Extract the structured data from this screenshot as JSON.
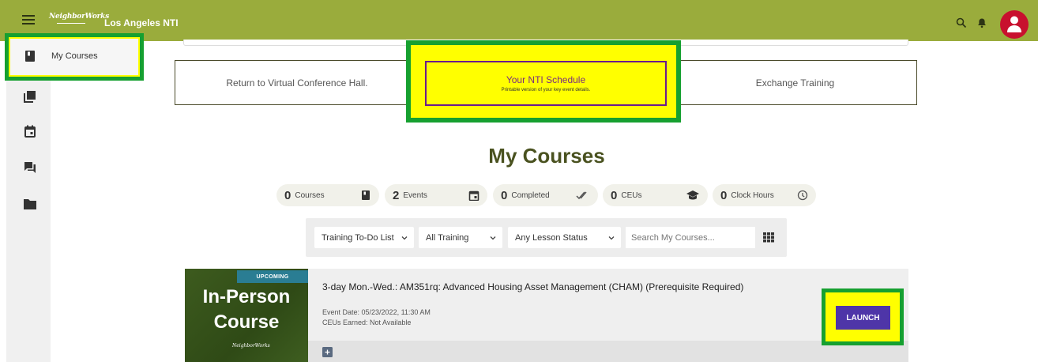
{
  "header": {
    "logo_text": "NeighborWorks",
    "app_title": "Los Angeles NTI",
    "icons": [
      "menu-icon",
      "search-icon",
      "bell-icon",
      "user-avatar-icon"
    ]
  },
  "sidebar": {
    "active_item_label": "My Courses",
    "icons": [
      "book-icon",
      "library-icon",
      "calendar-icon",
      "chat-icon",
      "folder-icon"
    ]
  },
  "nav": {
    "return_label": "Return to Virtual Conference Hall.",
    "schedule_title": "Your NTI Schedule",
    "schedule_subtitle": "Printable version of your key event details.",
    "exchange_label": "Exchange Training"
  },
  "page_title": "My Courses",
  "stats": [
    {
      "value": "0",
      "label": "Courses",
      "icon": "book-icon"
    },
    {
      "value": "2",
      "label": "Events",
      "icon": "calendar-icon"
    },
    {
      "value": "0",
      "label": "Completed",
      "icon": "double-check-icon"
    },
    {
      "value": "0",
      "label": "CEUs",
      "icon": "graduation-cap-icon"
    },
    {
      "value": "0",
      "label": "Clock Hours",
      "icon": "clock-icon"
    }
  ],
  "filters": {
    "list": "Training To-Do List",
    "training": "All Training",
    "status": "Any Lesson Status",
    "search_placeholder": "Search My Courses..."
  },
  "course": {
    "badge": "UPCOMING",
    "thumb_line1": "In-Person",
    "thumb_line2": "Course",
    "thumb_logo": "NeighborWorks",
    "title": "3-day Mon.-Wed.: AM351rq: Advanced Housing Asset Management (CHAM) (Prerequisite Required)",
    "event_date": "Event Date: 05/23/2022, 11:30 AM",
    "ceus": "CEUs Earned: Not Available",
    "launch_label": "LAUNCH"
  },
  "colors": {
    "header_green": "#9aac3c",
    "highlight_border": "#16a030",
    "highlight_fill": "#ffff00",
    "launch_purple": "#4e35a8",
    "avatar_red": "#c8102e",
    "badge_teal": "#2a7d93"
  }
}
